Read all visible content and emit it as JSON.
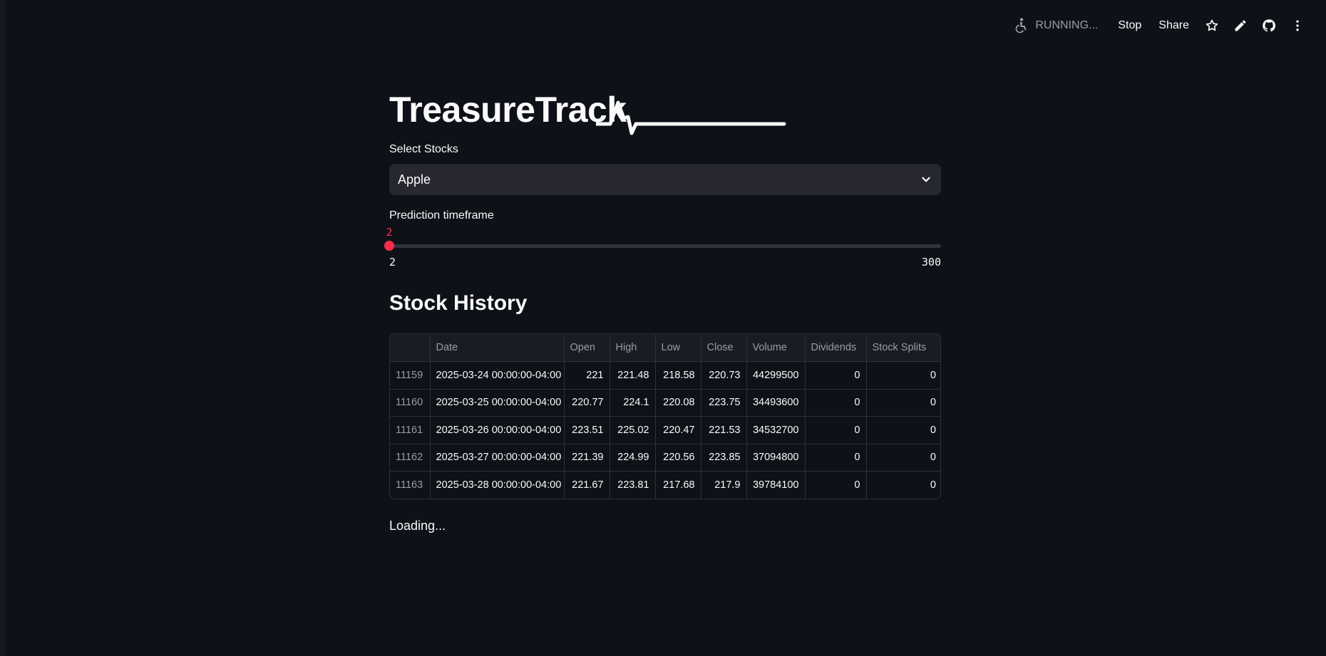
{
  "toolbar": {
    "status": "RUNNING...",
    "stop_label": "Stop",
    "share_label": "Share",
    "icons": [
      "running-figure-icon",
      "star-icon",
      "pencil-icon",
      "github-icon",
      "more-vertical-icon"
    ]
  },
  "app": {
    "title": "TreasureTrack",
    "accent_color": "#ff2b4a",
    "background_color": "#0e1117"
  },
  "select_stocks": {
    "label": "Select Stocks",
    "value": "Apple"
  },
  "prediction": {
    "label": "Prediction timeframe",
    "value": 2,
    "value_label": "2",
    "min": 2,
    "max": 300,
    "min_label": "2",
    "max_label": "300"
  },
  "history": {
    "title": "Stock History",
    "columns": [
      "",
      "Date",
      "Open",
      "High",
      "Low",
      "Close",
      "Volume",
      "Dividends",
      "Stock Splits"
    ],
    "rows": [
      [
        "11159",
        "2025-03-24 00:00:00-04:00",
        "221",
        "221.48",
        "218.58",
        "220.73",
        "44299500",
        "0",
        "0"
      ],
      [
        "11160",
        "2025-03-25 00:00:00-04:00",
        "220.77",
        "224.1",
        "220.08",
        "223.75",
        "34493600",
        "0",
        "0"
      ],
      [
        "11161",
        "2025-03-26 00:00:00-04:00",
        "223.51",
        "225.02",
        "220.47",
        "221.53",
        "34532700",
        "0",
        "0"
      ],
      [
        "11162",
        "2025-03-27 00:00:00-04:00",
        "221.39",
        "224.99",
        "220.56",
        "223.85",
        "37094800",
        "0",
        "0"
      ],
      [
        "11163",
        "2025-03-28 00:00:00-04:00",
        "221.67",
        "223.81",
        "217.68",
        "217.9",
        "39784100",
        "0",
        "0"
      ]
    ]
  },
  "loading_text": "Loading..."
}
